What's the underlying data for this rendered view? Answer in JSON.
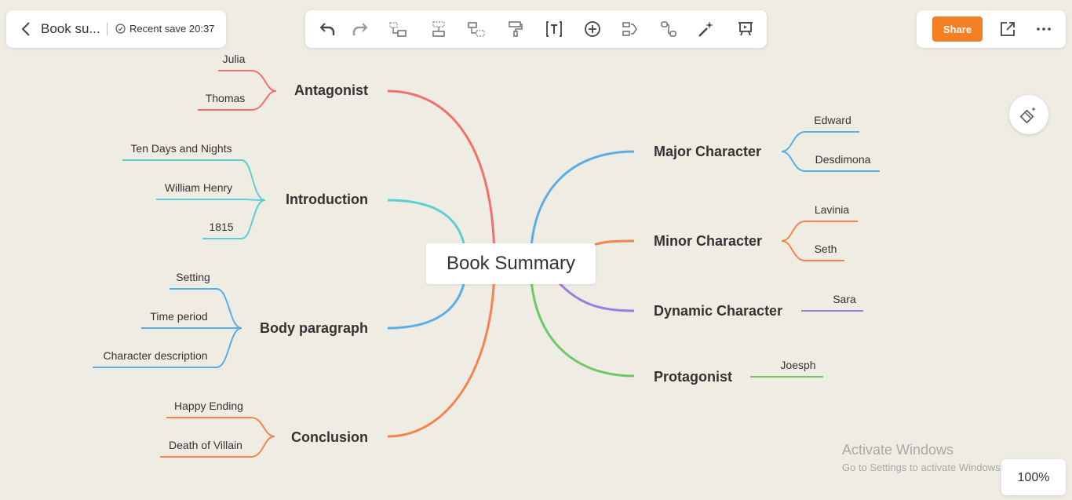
{
  "header": {
    "doc_title": "Book su...",
    "save_status": "Recent save 20:37"
  },
  "toolbar": {
    "tools": [
      "undo-icon",
      "redo-icon",
      "add-subtopic-icon",
      "add-sibling-icon",
      "add-parent-icon",
      "format-painter-icon",
      "text-icon",
      "insert-icon",
      "relationship-icon",
      "connector-icon",
      "magic-icon",
      "presentation-icon"
    ]
  },
  "actions": {
    "share_label": "Share"
  },
  "zoom_label": "100%",
  "watermark": {
    "line1": "Activate Windows",
    "line2": "Go to Settings to activate Windows."
  },
  "colors": {
    "accent": "#f47e23",
    "antagonist": "#f0706a",
    "introduction": "#5ccfd4",
    "body": "#5aaee8",
    "conclusion": "#f4854a",
    "major": "#5aaee8",
    "minor": "#f4854a",
    "dynamic": "#9b7ee0",
    "protagonist": "#6cc966"
  },
  "mindmap": {
    "root": "Book Summary",
    "left": [
      {
        "label": "Antagonist",
        "children": [
          "Julia",
          "Thomas"
        ]
      },
      {
        "label": "Introduction",
        "children": [
          "Ten Days and Nights",
          "William Henry",
          "1815"
        ]
      },
      {
        "label": "Body paragraph",
        "children": [
          "Setting",
          "Time period",
          "Character description"
        ]
      },
      {
        "label": "Conclusion",
        "children": [
          "Happy Ending",
          "Death of Villain"
        ]
      }
    ],
    "right": [
      {
        "label": "Major Character",
        "children": [
          "Edward",
          "Desdimona"
        ]
      },
      {
        "label": "Minor Character",
        "children": [
          "Lavinia",
          "Seth"
        ]
      },
      {
        "label": "Dynamic Character",
        "children": [
          "Sara"
        ]
      },
      {
        "label": "Protagonist",
        "children": [
          "Joesph"
        ]
      }
    ]
  }
}
